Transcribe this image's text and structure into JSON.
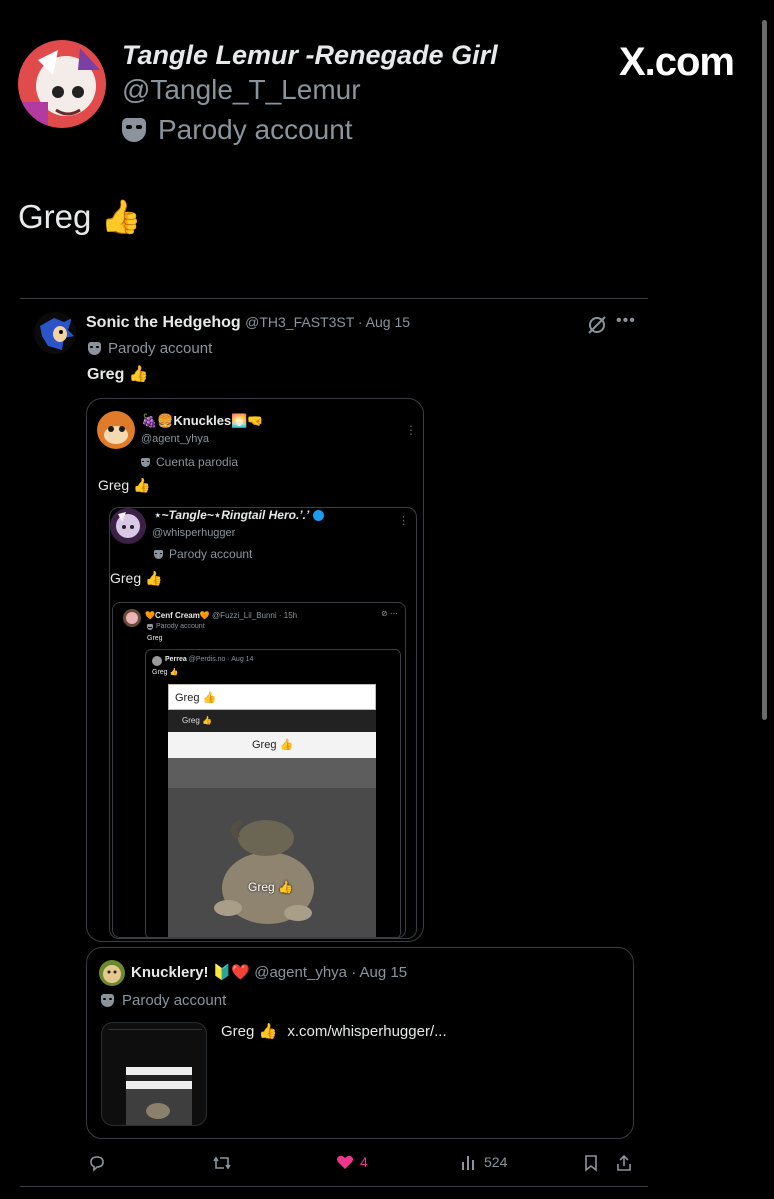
{
  "site_logo": "X.com",
  "post": {
    "author_name": "Tangle Lemur -Renegade Girl",
    "author_handle": "@Tangle_T_Lemur",
    "parody_label": "Parody account",
    "text": "Greg 👍"
  },
  "quoted": {
    "author_name": "Sonic the Hedgehog",
    "meta": "@TH3_FAST3ST · Aug 15",
    "parody_label": "Parody account",
    "text": "Greg 👍"
  },
  "nested1": {
    "author_name": "🍇🍔Knuckles🌅🤜",
    "handle": "@agent_yhya",
    "parody_label": "Cuenta parodia",
    "text": "Greg 👍"
  },
  "nested2": {
    "author_name": "⋆~Tangle~⋆Ringtail Hero.’.’",
    "handle": "@whisperhugger",
    "parody_label": "Parody account",
    "text": "Greg 👍"
  },
  "nested3": {
    "author_name": "🧡Cenf Cream🧡",
    "meta": "@Fuzzi_Lil_Bunni · 15h",
    "parody_label": "Parody account",
    "text": "Greg"
  },
  "nested4": {
    "author_name": "Perrea",
    "meta": "@Perdis.no · Aug 14",
    "text": "Greg 👍"
  },
  "meme": {
    "bar1": "Greg 👍",
    "bar2": "Greg 👍",
    "bar3": "Greg 👍",
    "caption": "Greg 👍"
  },
  "reply_card": {
    "author_name": "Knucklery! 🔰❤️",
    "meta": "@agent_yhya · Aug 15",
    "parody_label": "Parody account",
    "text": "Greg 👍",
    "link": "x.com/whisperhugger/..."
  },
  "actions": {
    "likes": "4",
    "views": "524"
  },
  "colors": {
    "background": "#000000",
    "text": "#e7e9ea",
    "muted": "#8b949c",
    "like": "#f0358f",
    "verified": "#1d9bf0"
  }
}
